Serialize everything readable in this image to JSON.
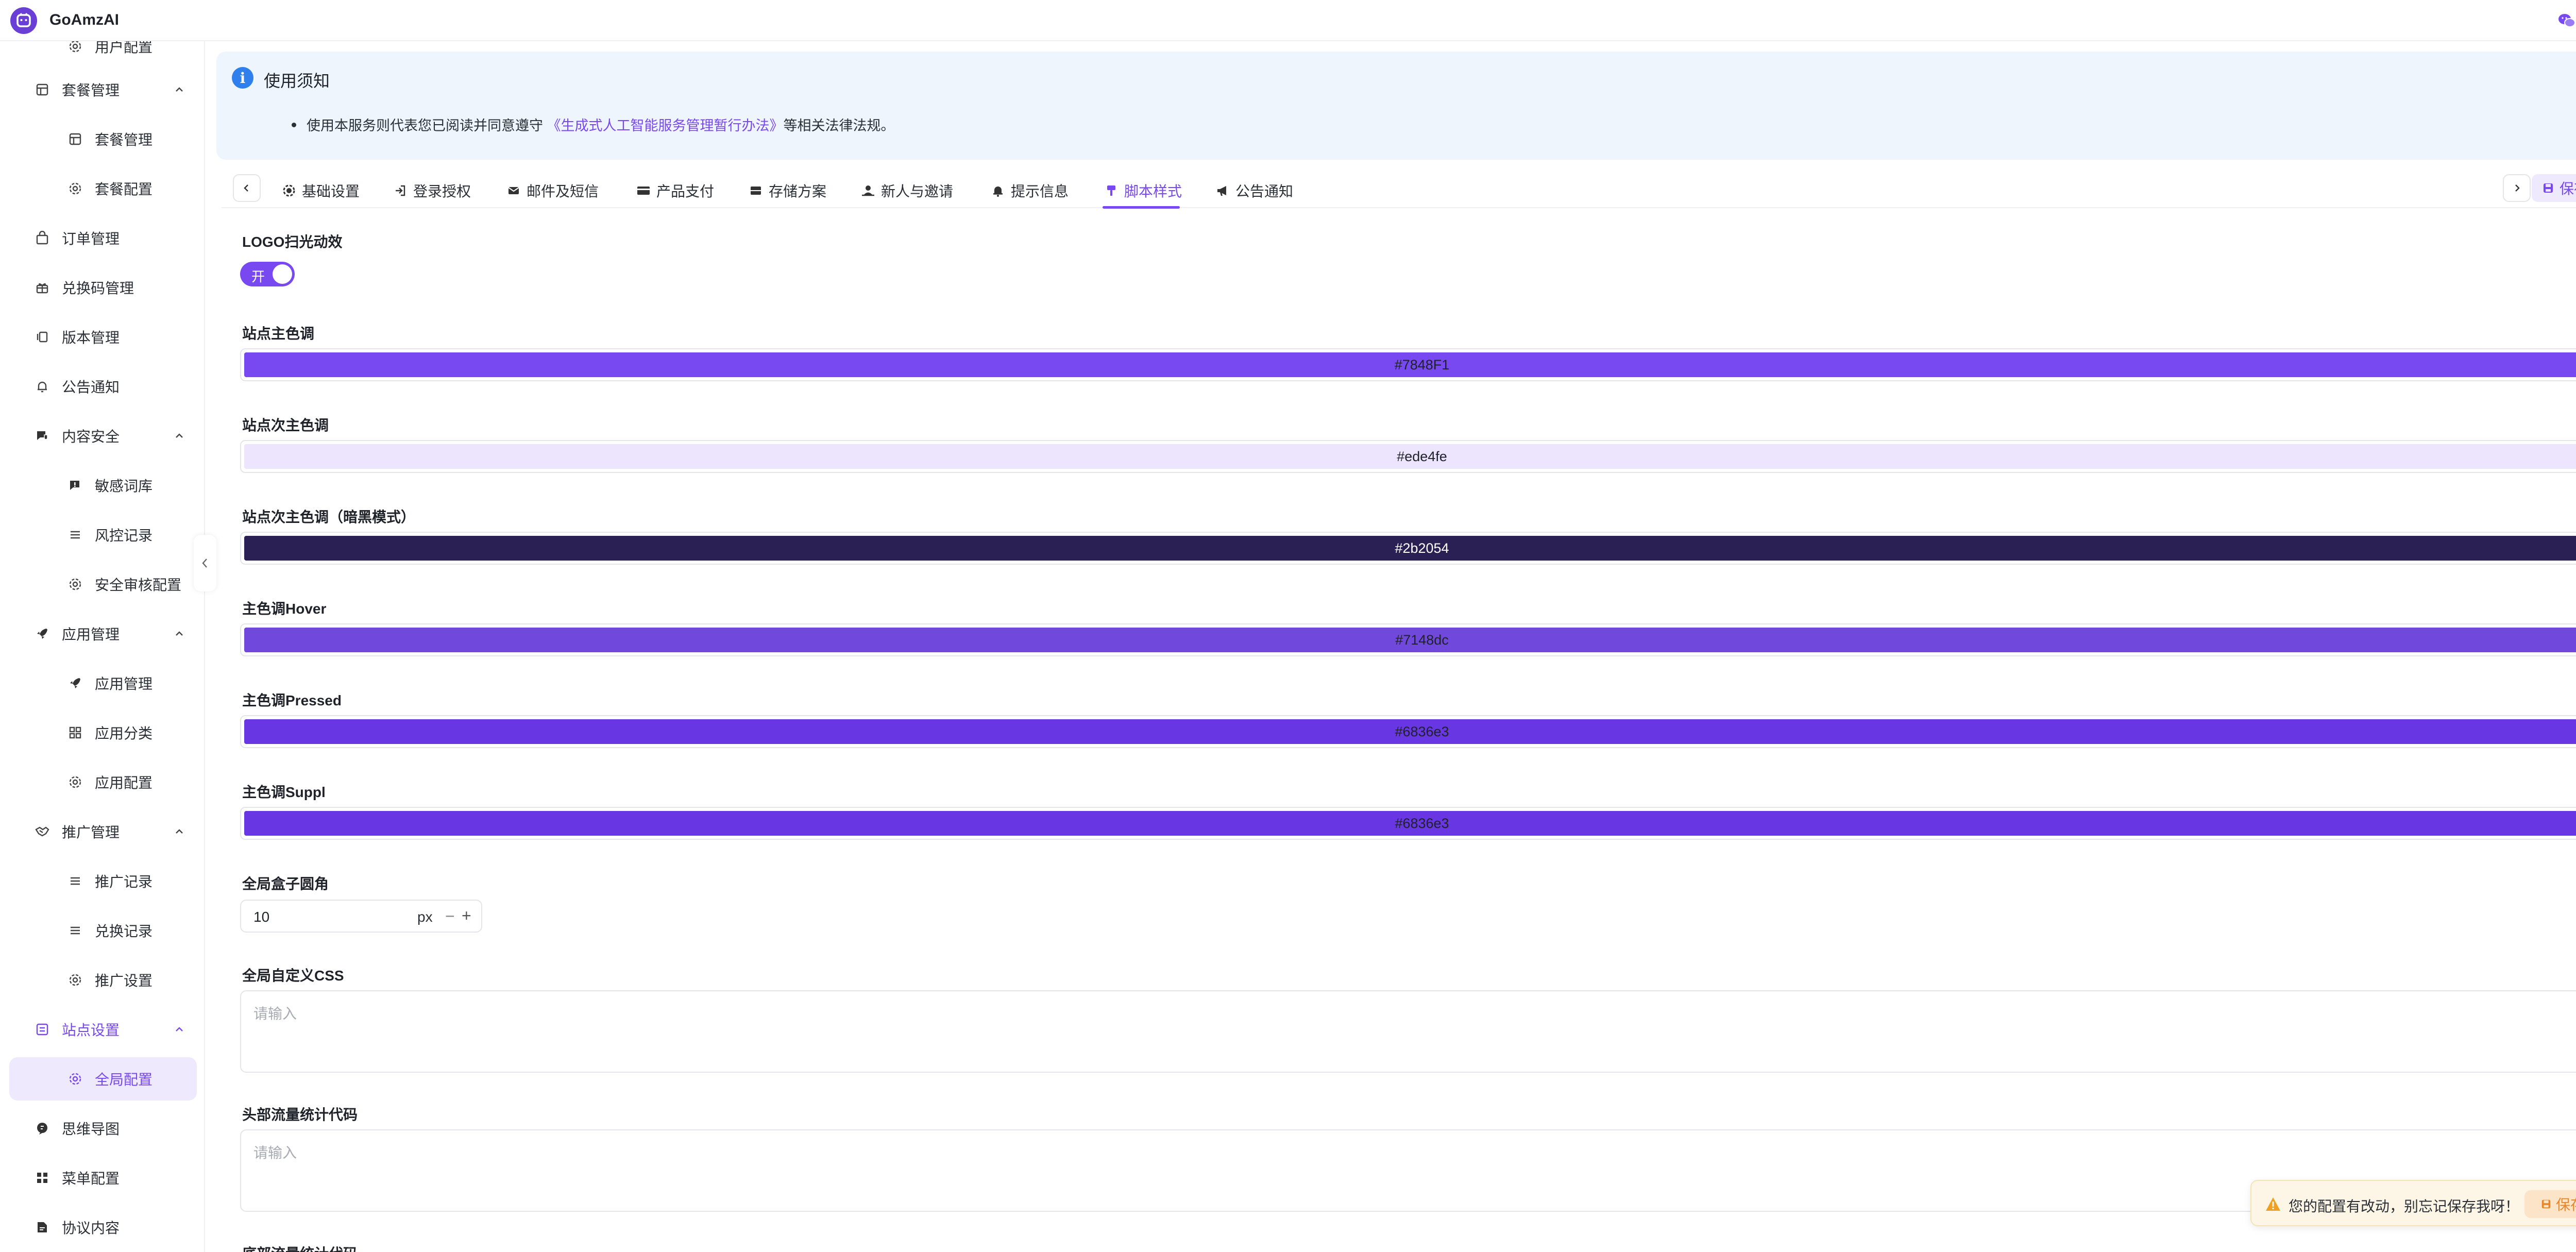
{
  "app": {
    "name": "GoAmzAI"
  },
  "sidebar": {
    "items": [
      {
        "label": "用户配置",
        "icon": "gear-icon"
      },
      {
        "label": "套餐管理",
        "icon": "package-icon",
        "expanded": true
      },
      {
        "label": "套餐管理",
        "icon": "package-icon"
      },
      {
        "label": "套餐配置",
        "icon": "gear-icon"
      },
      {
        "label": "订单管理",
        "icon": "shopping-bag-icon"
      },
      {
        "label": "兑换码管理",
        "icon": "gift-icon"
      },
      {
        "label": "版本管理",
        "icon": "version-icon"
      },
      {
        "label": "公告通知",
        "icon": "bell-icon"
      },
      {
        "label": "内容安全",
        "icon": "shield-chat-icon",
        "expanded": true
      },
      {
        "label": "敏感词库",
        "icon": "chat-alert-icon"
      },
      {
        "label": "风控记录",
        "icon": "list-icon"
      },
      {
        "label": "安全审核配置",
        "icon": "gear-icon"
      },
      {
        "label": "应用管理",
        "icon": "rocket-icon",
        "expanded": true
      },
      {
        "label": "应用管理",
        "icon": "rocket-icon"
      },
      {
        "label": "应用分类",
        "icon": "grid-icon"
      },
      {
        "label": "应用配置",
        "icon": "gear-icon"
      },
      {
        "label": "推广管理",
        "icon": "handshake-icon",
        "expanded": true
      },
      {
        "label": "推广记录",
        "icon": "list-icon"
      },
      {
        "label": "兑换记录",
        "icon": "list-icon"
      },
      {
        "label": "推广设置",
        "icon": "gear-icon"
      },
      {
        "label": "站点设置",
        "icon": "site-icon",
        "expanded": true
      },
      {
        "label": "全局配置",
        "icon": "gear-icon",
        "active": true
      },
      {
        "label": "思维导图",
        "icon": "mindmap-icon"
      },
      {
        "label": "菜单配置",
        "icon": "grid-icon"
      },
      {
        "label": "协议内容",
        "icon": "document-icon"
      }
    ]
  },
  "notice": {
    "title": "使用须知",
    "line_prefix": "使用本服务则代表您已阅读并同意遵守",
    "link": "《生成式人工智能服务管理暂行办法》",
    "line_suffix": "等相关法律法规。"
  },
  "tabs": {
    "items": [
      {
        "label": "基础设置",
        "icon": "gear-icon"
      },
      {
        "label": "登录授权",
        "icon": "login-icon"
      },
      {
        "label": "邮件及短信",
        "icon": "mail-icon"
      },
      {
        "label": "产品支付",
        "icon": "credit-card-icon"
      },
      {
        "label": "存储方案",
        "icon": "storage-icon"
      },
      {
        "label": "新人与邀请",
        "icon": "user-invite-icon"
      },
      {
        "label": "提示信息",
        "icon": "bell-icon"
      },
      {
        "label": "脚本样式",
        "icon": "brush-icon",
        "active": true
      },
      {
        "label": "公告通知",
        "icon": "megaphone-icon"
      }
    ],
    "save_label": "保存"
  },
  "form": {
    "logo_scan_label": "LOGO扫光动效",
    "logo_scan_toggle_text": "开",
    "logo_scan_on": true,
    "colors": [
      {
        "label": "站点主色调",
        "value": "#7848F1",
        "bg": "#7848f1",
        "fg": "#1f2329"
      },
      {
        "label": "站点次主色调",
        "value": "#ede4fe",
        "bg": "#ede4fe",
        "fg": "#1f2329"
      },
      {
        "label": "站点次主色调（暗黑模式）",
        "value": "#2b2054",
        "bg": "#2b2054",
        "fg": "#ffffff"
      },
      {
        "label": "主色调Hover",
        "value": "#7148dc",
        "bg": "#7148dc",
        "fg": "#1f2329"
      },
      {
        "label": "主色调Pressed",
        "value": "#6836e3",
        "bg": "#6836e3",
        "fg": "#1f2329"
      },
      {
        "label": "主色调Suppl",
        "value": "#6836e3",
        "bg": "#6836e3",
        "fg": "#1f2329"
      }
    ],
    "radius_label": "全局盒子圆角",
    "radius_value": "10",
    "radius_unit": "px",
    "css_label": "全局自定义CSS",
    "css_placeholder": "请输入",
    "head_code_label": "头部流量统计代码",
    "head_code_placeholder": "请输入",
    "foot_code_label": "底部流量统计代码"
  },
  "toast": {
    "message": "您的配置有改动，别忘记保存我呀！",
    "button": "保存"
  }
}
